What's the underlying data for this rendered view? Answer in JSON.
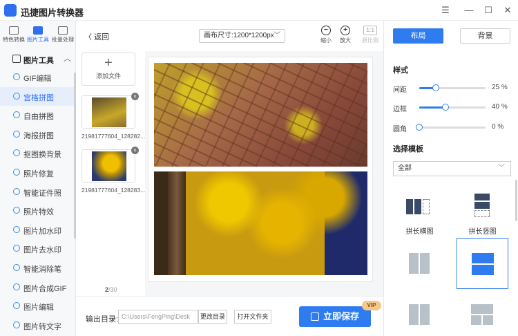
{
  "app": {
    "title": "迅捷图片转换器"
  },
  "window": {
    "menu": "☰",
    "minimize": "—",
    "maximize": "☐",
    "close": "✕"
  },
  "modes": [
    {
      "label": "特色转换"
    },
    {
      "label": "图片工具"
    },
    {
      "label": "批量处理"
    }
  ],
  "sidebar": {
    "section_title": "图片工具",
    "items": [
      {
        "label": "GIF编辑"
      },
      {
        "label": "宫格拼图"
      },
      {
        "label": "自由拼图"
      },
      {
        "label": "海报拼图"
      },
      {
        "label": "抠图换背景"
      },
      {
        "label": "照片修复"
      },
      {
        "label": "智能证件照"
      },
      {
        "label": "照片特效"
      },
      {
        "label": "图片加水印"
      },
      {
        "label": "图片去水印"
      },
      {
        "label": "智能消除笔"
      },
      {
        "label": "图片合成GIF"
      },
      {
        "label": "图片编辑"
      },
      {
        "label": "图片转文字"
      }
    ]
  },
  "toolbar": {
    "back": "返回",
    "canvas_size": "画布尺寸:1200*1200px",
    "zoom_out": "缩小",
    "zoom_in": "放大",
    "original_ratio_icon": "1:1",
    "original_ratio": "原比例"
  },
  "files": {
    "add_label": "添加文件",
    "items": [
      {
        "name": "21981777604_128282..."
      },
      {
        "name": "21981777604_128283..."
      }
    ],
    "page_current": "2",
    "page_total": "/30"
  },
  "bottom": {
    "output_label": "输出目录:",
    "output_path": "C:\\Users\\FengPing\\Desk",
    "change_dir": "更改目录",
    "open_folder": "打开文件夹",
    "save": "立即保存",
    "vip": "VIP"
  },
  "panel": {
    "tab_layout": "布局",
    "tab_background": "背景",
    "style_title": "样式",
    "spacing_label": "间距",
    "spacing_value": "25 %",
    "spacing_level": 25,
    "border_label": "边框",
    "border_value": "40 %",
    "border_level": 40,
    "corner_label": "圆角",
    "corner_value": "0 %",
    "corner_level": 0,
    "template_title": "选择模板",
    "template_select": "全部",
    "templates": [
      {
        "label": "拼长横图"
      },
      {
        "label": "拼长竖图"
      }
    ]
  },
  "colors": {
    "accent": "#2f7cf0",
    "vip": "#f6c98a"
  }
}
